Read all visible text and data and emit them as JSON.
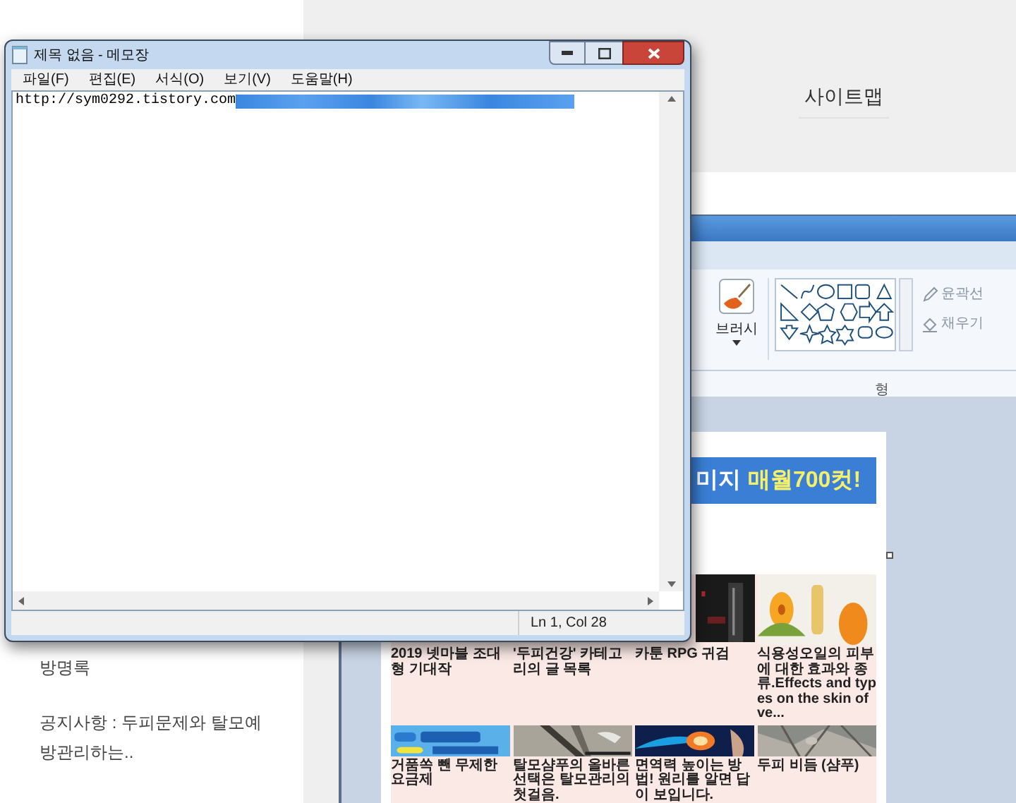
{
  "blog": {
    "sitemap": "사이트맵",
    "sidebar": [
      "방명록",
      "공지사항 : 두피문제와 탈모예방관리하는.."
    ]
  },
  "paint": {
    "brush_label": "브러시",
    "outline_label": "윤곽선",
    "fill_label": "채우기",
    "group_label": "형"
  },
  "ad": {
    "banner": [
      {
        "kind": "plain",
        "text": "미지"
      },
      {
        "kind": "highlight",
        "text": "매월700컷!"
      }
    ],
    "rows": [
      [
        {
          "kind": "caption",
          "caption": "2019 넷마블 조대형 기대작"
        },
        {
          "kind": "caption",
          "caption": "'두피건강' 카테고리의 글 목록"
        },
        {
          "kind": "cropped_picture",
          "caption": "카툰 RPG 귀검"
        },
        {
          "kind": "picture",
          "caption": "식용성오일의 피부에 대한 효과와 종류.Effects and types on the skin of ve..."
        }
      ],
      [
        {
          "kind": "picture",
          "caption": "거품쏙 뺀 무제한 요금제"
        },
        {
          "kind": "picture",
          "caption": "탈모샴푸의 올바른 선택은 탈모관리의 첫걸음."
        },
        {
          "kind": "picture",
          "caption": "면역력 높이는 방법! 원리를 알면 답이 보입니다."
        },
        {
          "kind": "picture",
          "caption": "두피 비듬 (샴푸)"
        }
      ]
    ]
  },
  "notepad": {
    "title": "제목 없음 - 메모장",
    "menu": [
      "파일(F)",
      "편집(E)",
      "서식(O)",
      "보기(V)",
      "도움말(H)"
    ],
    "content": "http://sym0292.tistory.com",
    "status": "Ln 1, Col 28"
  }
}
